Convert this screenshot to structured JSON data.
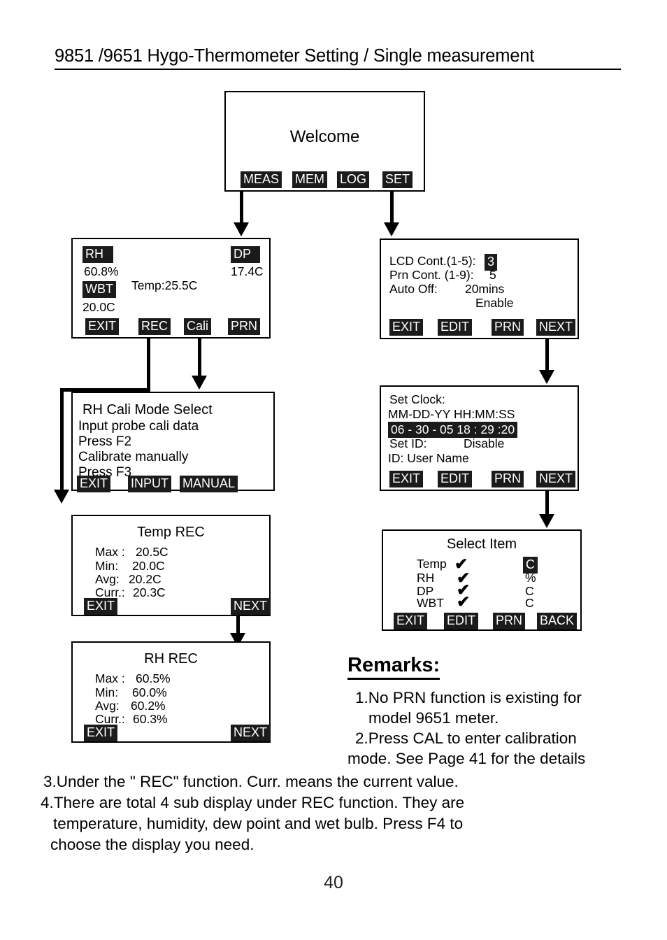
{
  "document": {
    "title": "9851 /9651 Hygo-Thermometer Setting / Single measurement",
    "page_number": "40"
  },
  "screens": {
    "welcome": {
      "title": "Welcome",
      "softkeys": [
        "MEAS",
        "MEM",
        "LOG",
        "SET"
      ]
    },
    "measurement": {
      "rh_label": "RH",
      "rh_value": "60.8%",
      "dp_label": "DP",
      "dp_value": "17.4C",
      "temp_line": "Temp:25.5C",
      "wbt_label": "WBT",
      "wbt_value": "20.0C",
      "softkeys": [
        "EXIT",
        "REC",
        "Cali",
        "PRN"
      ]
    },
    "lcd_settings": {
      "line1_label": "LCD Cont.(1-5):",
      "line1_value": "3",
      "line2_label": "Prn Cont.  (1-9):",
      "line2_value": "5",
      "line3_label": "Auto Off:",
      "line3_value": "20mins",
      "line4_value": "Enable",
      "softkeys": [
        "EXIT",
        "EDIT",
        "PRN",
        "NEXT"
      ]
    },
    "rh_cali": {
      "title": "RH Cali Mode Select",
      "line1": "Input probe cali data",
      "line2": "Press F2",
      "line3": "Calibrate manually",
      "line4": "Press F3",
      "softkeys": [
        "EXIT",
        "INPUT",
        "MANUAL"
      ]
    },
    "set_clock": {
      "title": "Set Clock:",
      "format": "MM-DD-YY HH:MM:SS",
      "value": "06 - 30 - 05  18 : 29 :20",
      "set_id_label": "Set ID:",
      "set_id_value": "Disable",
      "id_line": "ID: User Name",
      "softkeys": [
        "EXIT",
        "EDIT",
        "PRN",
        "NEXT"
      ]
    },
    "temp_rec": {
      "title": "Temp REC",
      "rows": [
        {
          "label": "Max :",
          "value": "20.5C"
        },
        {
          "label": "Min:",
          "value": "20.0C"
        },
        {
          "label": "Avg:",
          "value": "20.2C"
        },
        {
          "label": "Curr.:",
          "value": "20.3C"
        }
      ],
      "softkeys": [
        "EXIT",
        "NEXT"
      ]
    },
    "rh_rec": {
      "title": "RH  REC",
      "rows": [
        {
          "label": "Max :",
          "value": "60.5%"
        },
        {
          "label": "Min:",
          "value": "60.0%"
        },
        {
          "label": "Avg:",
          "value": "60.2%"
        },
        {
          "label": "Curr.:",
          "value": "60.3%"
        }
      ],
      "softkeys": [
        "EXIT",
        "NEXT"
      ]
    },
    "select_item": {
      "title": "Select Item",
      "rows": [
        {
          "name": "Temp",
          "check": "✔",
          "unit": "C",
          "unit_highlighted": true
        },
        {
          "name": "RH",
          "check": "✔",
          "unit": "%",
          "unit_highlighted": false
        },
        {
          "name": "DP",
          "check": "✔",
          "unit": "C",
          "unit_highlighted": false
        },
        {
          "name": "WBT",
          "check": "✔",
          "unit": "C",
          "unit_highlighted": false
        }
      ],
      "softkeys": [
        "EXIT",
        "EDIT",
        "PRN",
        "BACK"
      ]
    }
  },
  "remarks": {
    "heading": "Remarks:",
    "lines": [
      "1.No PRN function is existing for",
      "model 9651 meter.",
      "2.Press CAL  to enter calibration",
      "mode. See Page 41 for the details",
      "3.Under the \" REC\" function. Curr. means the current value.",
      "4.There are total 4 sub display under REC function. They are",
      "temperature, humidity, dew point and wet bulb. Press F4 to",
      "choose the display you need."
    ]
  }
}
